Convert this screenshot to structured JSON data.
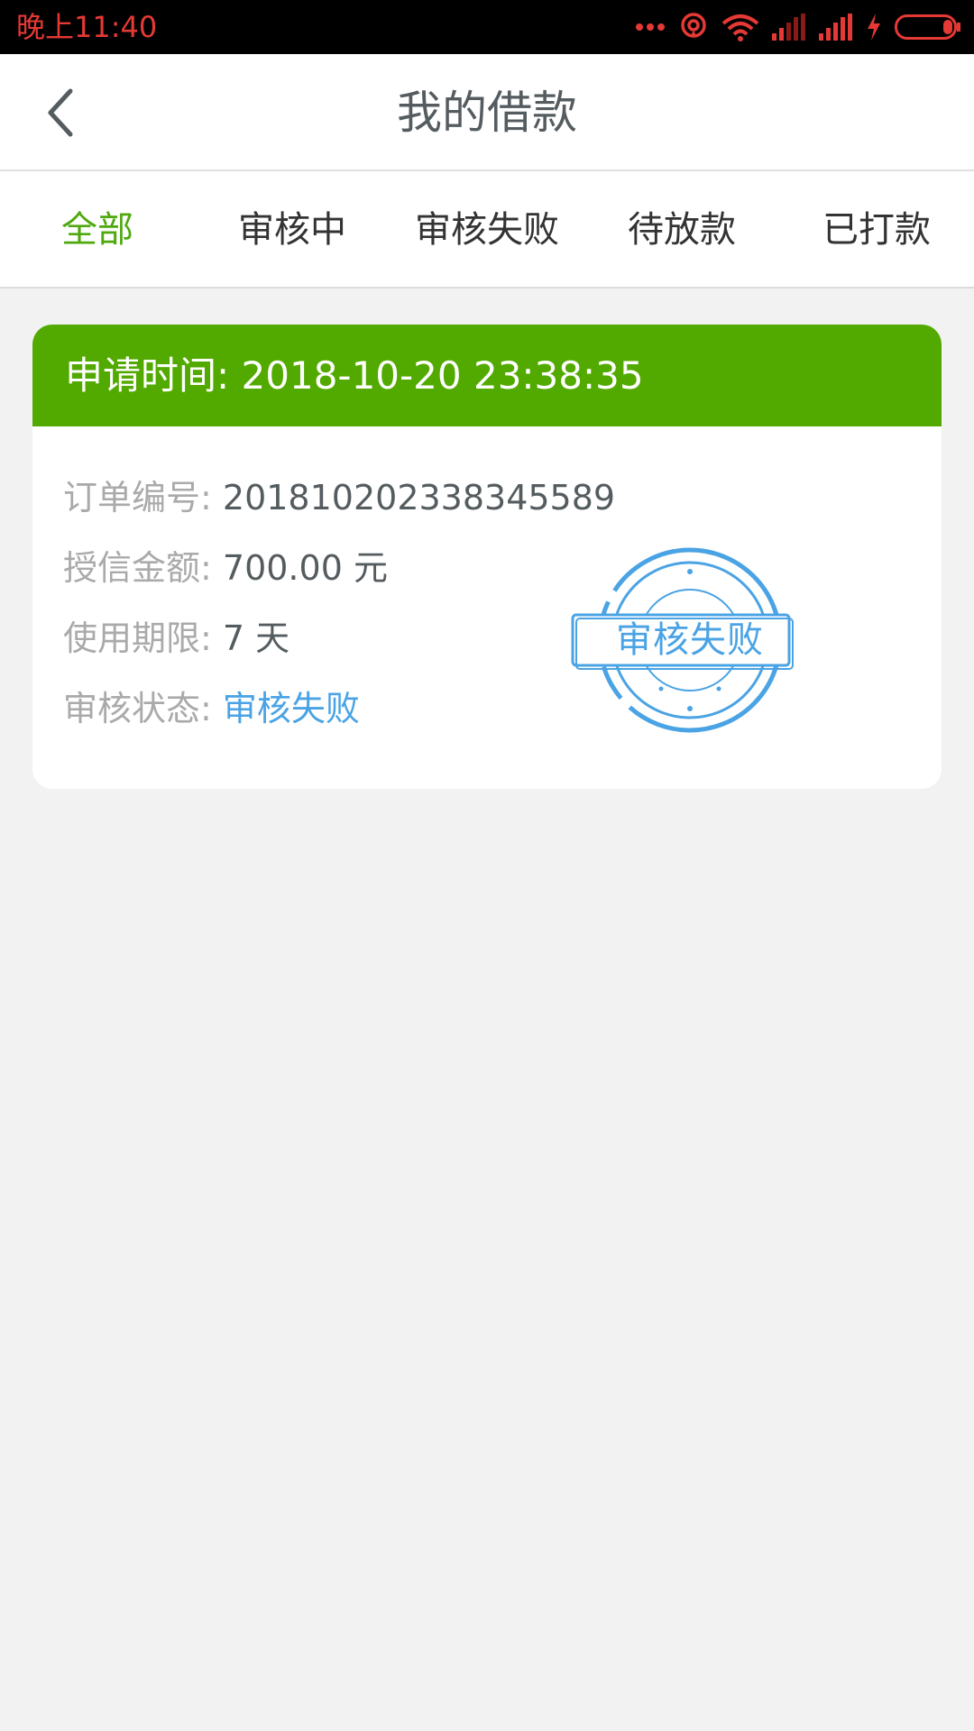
{
  "status_bar": {
    "time": "晚上11:40",
    "icons": [
      "more-dots-icon",
      "hotspot-icon",
      "wifi-icon",
      "signal-icon",
      "signal-icon",
      "charging-icon",
      "battery-icon"
    ],
    "accent_color": "#e53935"
  },
  "header": {
    "title": "我的借款",
    "back_icon": "chevron-left-icon"
  },
  "tabs": {
    "items": [
      {
        "label": "全部",
        "active": true
      },
      {
        "label": "审核中",
        "active": false
      },
      {
        "label": "审核失败",
        "active": false
      },
      {
        "label": "待放款",
        "active": false
      },
      {
        "label": "已打款",
        "active": false
      }
    ],
    "active_color": "#4fa90e"
  },
  "loan_card": {
    "header_label": "申请时间",
    "header_sep": ":",
    "apply_time": "2018-10-20 23:38:35",
    "header_color": "#52aa00",
    "fields": [
      {
        "label": "订单编号:",
        "value": "201810202338345589"
      },
      {
        "label": "授信金额:",
        "value": "700.00 元"
      },
      {
        "label": "使用期限:",
        "value": "7 天"
      },
      {
        "label": "审核状态:",
        "value": "审核失败"
      }
    ],
    "stamp_text": "审核失败",
    "stamp_color": "#4aa3e4"
  }
}
